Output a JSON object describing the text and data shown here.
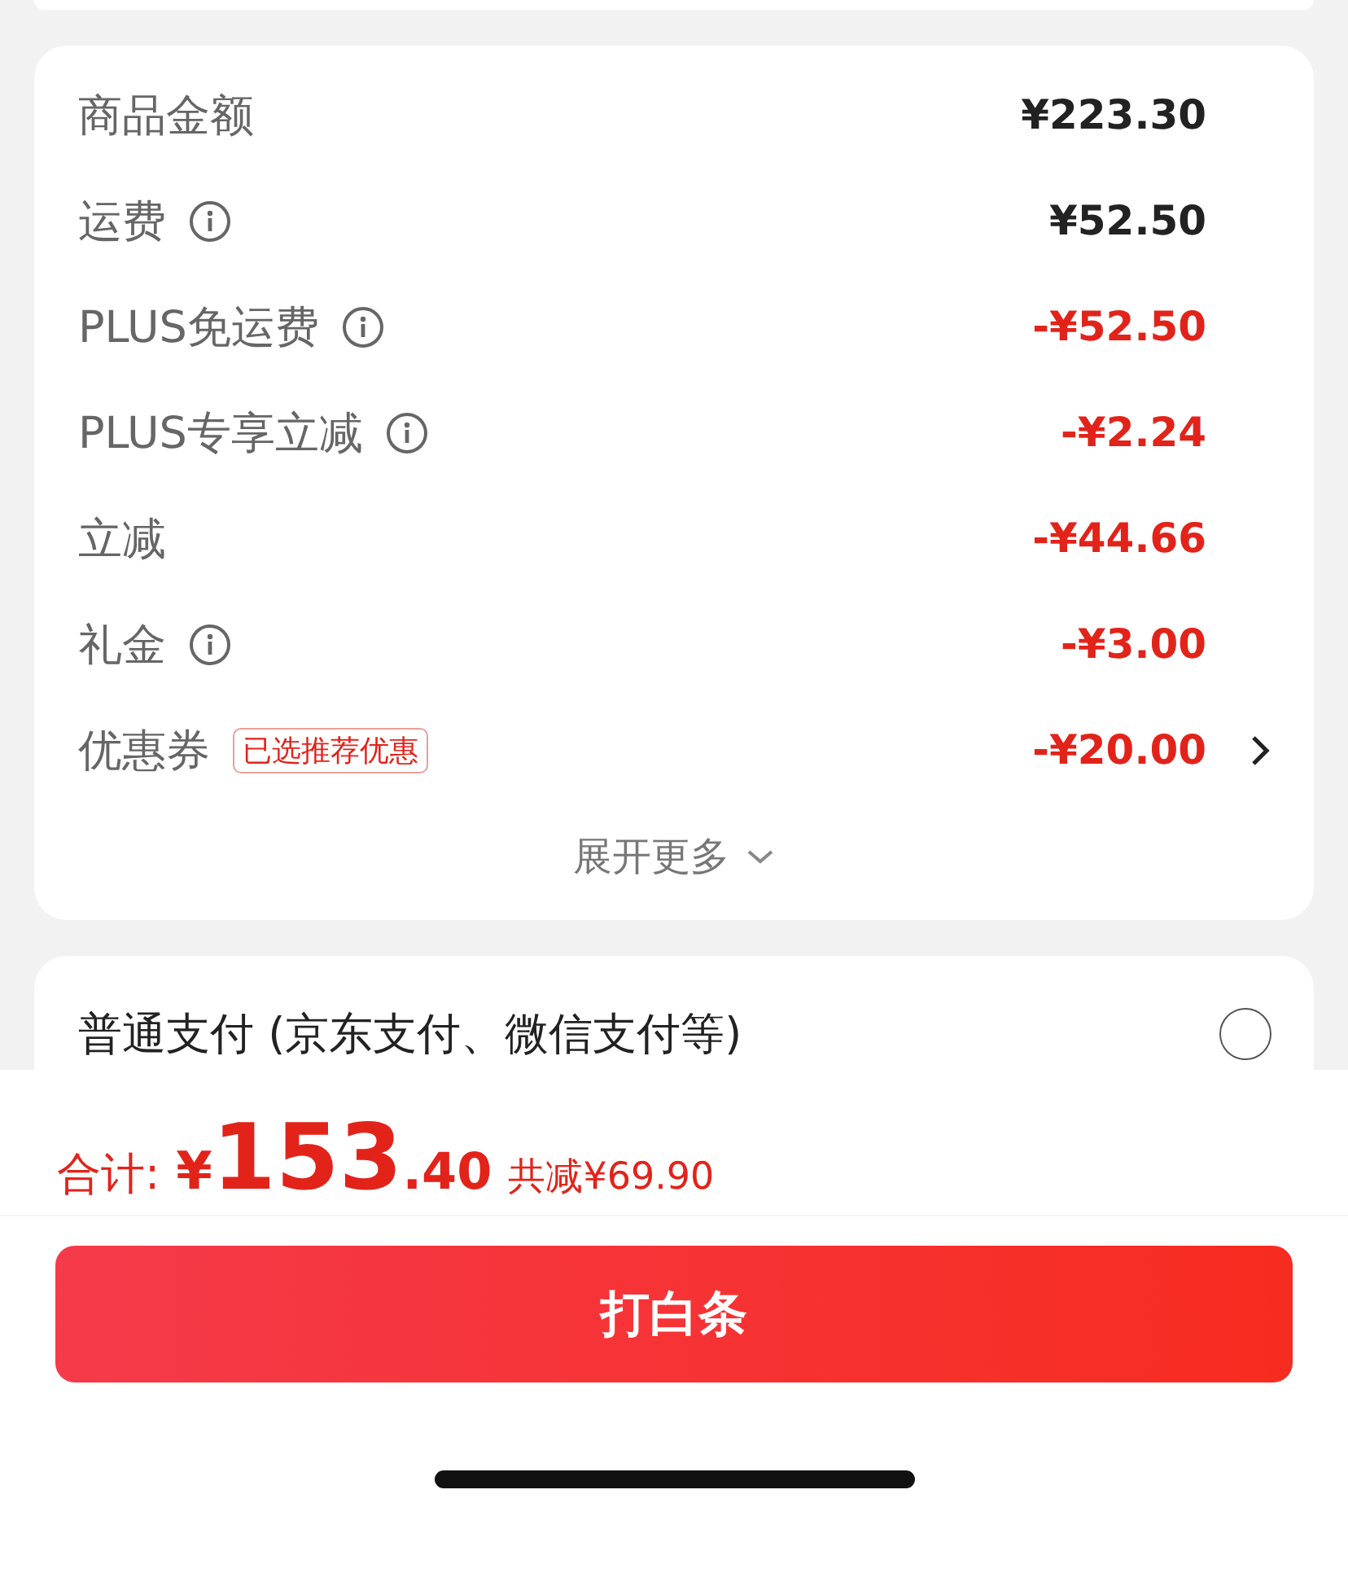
{
  "summary": {
    "rows": [
      {
        "label": "商品金额",
        "info": false,
        "amount": "¥223.30",
        "kind": "charge",
        "link": false
      },
      {
        "label": "运费",
        "info": true,
        "amount": "¥52.50",
        "kind": "charge",
        "link": false
      },
      {
        "label": "PLUS免运费",
        "info": true,
        "amount": "-¥52.50",
        "kind": "discount",
        "link": false
      },
      {
        "label": "PLUS专享立减",
        "info": true,
        "amount": "-¥2.24",
        "kind": "discount",
        "link": false
      },
      {
        "label": "立减",
        "info": false,
        "amount": "-¥44.66",
        "kind": "discount",
        "link": false
      },
      {
        "label": "礼金",
        "info": true,
        "amount": "-¥3.00",
        "kind": "discount",
        "link": false
      },
      {
        "label": "优惠券",
        "info": false,
        "badge": "已选推荐优惠",
        "amount": "-¥20.00",
        "kind": "discount",
        "link": true
      }
    ],
    "expand": "展开更多"
  },
  "payment": {
    "options": [
      {
        "label": "普通支付 (京东支付、微信支付等)",
        "selected": false
      }
    ]
  },
  "footer": {
    "total_label": "合计:",
    "currency": "¥",
    "integer": "153",
    "decimal": ".40",
    "saving": "共减¥69.90",
    "button": "打白条"
  }
}
